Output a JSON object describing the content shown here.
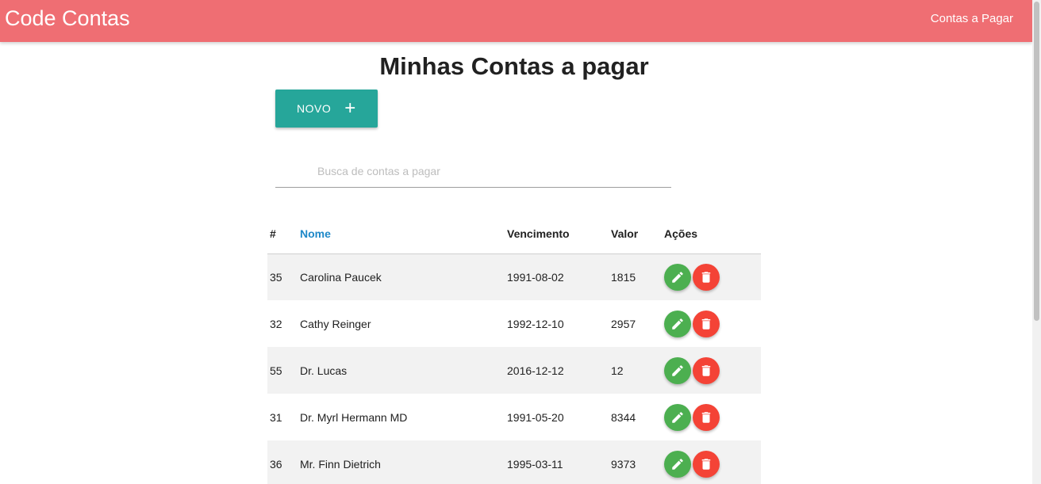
{
  "navbar": {
    "brand": "Code Contas",
    "link": "Contas a Pagar"
  },
  "page": {
    "title": "Minhas Contas a pagar"
  },
  "toolbar": {
    "new_label": "NOVO",
    "new_icon": "plus-icon"
  },
  "search": {
    "placeholder": "Busca de contas a pagar",
    "value": ""
  },
  "table": {
    "headers": {
      "id": "#",
      "name": "Nome",
      "due": "Vencimento",
      "value": "Valor",
      "actions": "Ações"
    },
    "sorted_column": "Nome",
    "rows": [
      {
        "id": "35",
        "name": "Carolina Paucek",
        "due": "1991-08-02",
        "value": "1815"
      },
      {
        "id": "32",
        "name": "Cathy Reinger",
        "due": "1992-12-10",
        "value": "2957"
      },
      {
        "id": "55",
        "name": "Dr. Lucas",
        "due": "2016-12-12",
        "value": "12"
      },
      {
        "id": "31",
        "name": "Dr. Myrl Hermann MD",
        "due": "1991-05-20",
        "value": "8344"
      },
      {
        "id": "36",
        "name": "Mr. Finn Dietrich",
        "due": "1995-03-11",
        "value": "9373"
      }
    ],
    "row_actions": {
      "edit_icon": "pencil-icon",
      "delete_icon": "trash-icon"
    }
  },
  "colors": {
    "navbar": "#ef6e73",
    "new_button": "#26a69a",
    "edit": "#4caf50",
    "delete": "#f44336",
    "sorted_header": "#1e88c8"
  }
}
